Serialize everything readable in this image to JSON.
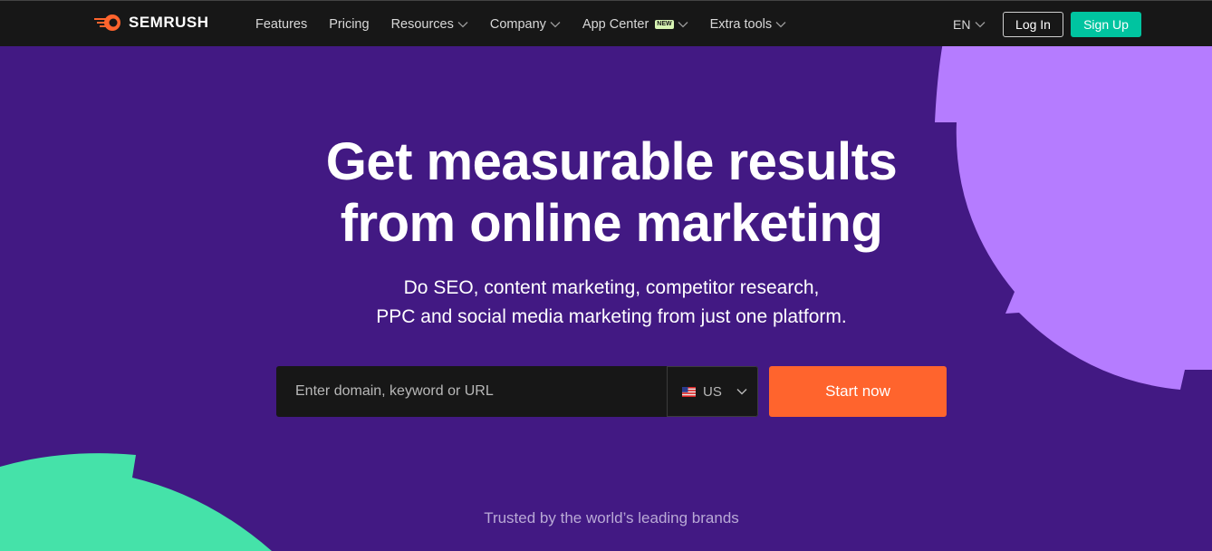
{
  "header": {
    "logo_text": "SEMRUSH",
    "nav": [
      {
        "label": "Features",
        "has_dropdown": false
      },
      {
        "label": "Pricing",
        "has_dropdown": false
      },
      {
        "label": "Resources",
        "has_dropdown": true
      },
      {
        "label": "Company",
        "has_dropdown": true
      },
      {
        "label": "App Center",
        "has_dropdown": true,
        "badge": "NEW"
      },
      {
        "label": "Extra tools",
        "has_dropdown": true
      }
    ],
    "language": "EN",
    "login_label": "Log In",
    "signup_label": "Sign Up"
  },
  "hero": {
    "title_line1": "Get measurable results",
    "title_line2": "from online marketing",
    "subtitle_line1": "Do SEO, content marketing, competitor research,",
    "subtitle_line2": "PPC and social media marketing from just one platform.",
    "search_placeholder": "Enter domain, keyword or URL",
    "country": "US",
    "start_label": "Start now",
    "trusted_text": "Trusted by the world’s leading brands"
  },
  "colors": {
    "background": "#421983",
    "header": "#171717",
    "signup": "#00c4a0",
    "start": "#ff642d",
    "shape_right": "#b57cff",
    "shape_left": "#45e2a9"
  },
  "icons": [
    "semrush-logo-icon",
    "chevron-down-icon",
    "us-flag-icon"
  ]
}
